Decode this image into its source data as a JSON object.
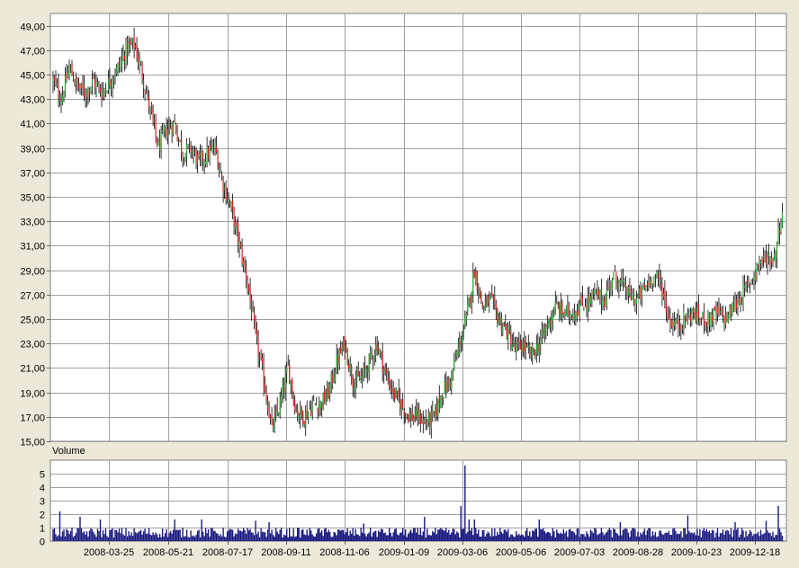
{
  "chart_data": [
    {
      "type": "candlestick",
      "title": "",
      "ylim": [
        15,
        50
      ],
      "y_ticks": [
        "49,00",
        "47,00",
        "45,00",
        "43,00",
        "41,00",
        "39,00",
        "37,00",
        "35,00",
        "33,00",
        "31,00",
        "29,00",
        "27,00",
        "25,00",
        "23,00",
        "21,00",
        "19,00",
        "17,00",
        "15,00"
      ],
      "x_ticks": [
        "2008-03-25",
        "2008-05-21",
        "2008-07-17",
        "2008-09-11",
        "2008-11-06",
        "2009-01-09",
        "2009-03-06",
        "2009-05-06",
        "2009-07-03",
        "2009-08-28",
        "2009-10-23",
        "2009-12-18"
      ],
      "grid": true,
      "up_color": "#2e9e2e",
      "down_color": "#d12020",
      "close_path": [
        [
          0,
          44.5
        ],
        [
          6,
          43.0
        ],
        [
          12,
          45.5
        ],
        [
          18,
          44.0
        ],
        [
          24,
          43.5
        ],
        [
          30,
          44.5
        ],
        [
          36,
          43.5
        ],
        [
          42,
          44.5
        ],
        [
          48,
          45.5
        ],
        [
          54,
          47.0
        ],
        [
          60,
          47.5
        ],
        [
          66,
          45.0
        ],
        [
          72,
          42.0
        ],
        [
          78,
          39.0
        ],
        [
          84,
          40.5
        ],
        [
          90,
          41.0
        ],
        [
          96,
          38.5
        ],
        [
          102,
          39.0
        ],
        [
          108,
          37.8
        ],
        [
          114,
          38.5
        ],
        [
          120,
          39.0
        ],
        [
          126,
          36.0
        ],
        [
          132,
          34.0
        ],
        [
          138,
          31.0
        ],
        [
          144,
          28.0
        ],
        [
          150,
          23.5
        ],
        [
          156,
          20.0
        ],
        [
          162,
          16.0
        ],
        [
          168,
          18.0
        ],
        [
          174,
          21.0
        ],
        [
          180,
          17.5
        ],
        [
          186,
          17.0
        ],
        [
          192,
          18.0
        ],
        [
          198,
          18.0
        ],
        [
          204,
          19.0
        ],
        [
          210,
          21.5
        ],
        [
          216,
          23.0
        ],
        [
          222,
          20.0
        ],
        [
          228,
          20.0
        ],
        [
          234,
          21.5
        ],
        [
          240,
          23.0
        ],
        [
          246,
          20.5
        ],
        [
          252,
          19.0
        ],
        [
          258,
          18.0
        ],
        [
          264,
          17.0
        ],
        [
          270,
          17.0
        ],
        [
          276,
          16.5
        ],
        [
          282,
          17.0
        ],
        [
          288,
          19.0
        ],
        [
          294,
          20.0
        ],
        [
          300,
          22.5
        ],
        [
          306,
          25.0
        ],
        [
          312,
          29.0
        ],
        [
          318,
          26.0
        ],
        [
          324,
          26.5
        ],
        [
          330,
          25.0
        ],
        [
          336,
          24.0
        ],
        [
          342,
          22.5
        ],
        [
          348,
          22.8
        ],
        [
          354,
          22.0
        ],
        [
          360,
          23.0
        ],
        [
          366,
          24.5
        ],
        [
          372,
          26.0
        ],
        [
          378,
          25.5
        ],
        [
          384,
          25.5
        ],
        [
          390,
          26.0
        ],
        [
          396,
          26.5
        ],
        [
          402,
          27.0
        ],
        [
          408,
          26.5
        ],
        [
          414,
          28.5
        ],
        [
          420,
          28.0
        ],
        [
          426,
          27.0
        ],
        [
          432,
          26.5
        ],
        [
          438,
          27.5
        ],
        [
          444,
          28.5
        ],
        [
          450,
          28.0
        ],
        [
          456,
          25.0
        ],
        [
          462,
          24.5
        ],
        [
          468,
          25.0
        ],
        [
          474,
          25.5
        ],
        [
          480,
          25.0
        ],
        [
          486,
          25.0
        ],
        [
          492,
          25.5
        ],
        [
          498,
          25.0
        ],
        [
          504,
          26.0
        ],
        [
          510,
          27.0
        ],
        [
          516,
          28.0
        ],
        [
          522,
          29.5
        ],
        [
          528,
          30.0
        ],
        [
          534,
          30.0
        ],
        [
          540,
          34.0
        ]
      ]
    },
    {
      "type": "bar",
      "title": "Volume",
      "ylim": [
        0,
        6
      ],
      "y_ticks": [
        "5",
        "4",
        "3",
        "2",
        "1",
        "0"
      ],
      "color": "#1a1a80",
      "spikes": [
        [
          5,
          2.2
        ],
        [
          20,
          1.8
        ],
        [
          35,
          1.6
        ],
        [
          90,
          1.6
        ],
        [
          110,
          1.6
        ],
        [
          150,
          1.5
        ],
        [
          160,
          1.4
        ],
        [
          230,
          1.3
        ],
        [
          275,
          1.8
        ],
        [
          302,
          2.6
        ],
        [
          305,
          5.6
        ],
        [
          308,
          1.6
        ],
        [
          312,
          1.6
        ],
        [
          360,
          1.6
        ],
        [
          420,
          1.4
        ],
        [
          470,
          1.9
        ],
        [
          505,
          1.4
        ],
        [
          528,
          1.5
        ],
        [
          537,
          2.6
        ]
      ]
    }
  ]
}
